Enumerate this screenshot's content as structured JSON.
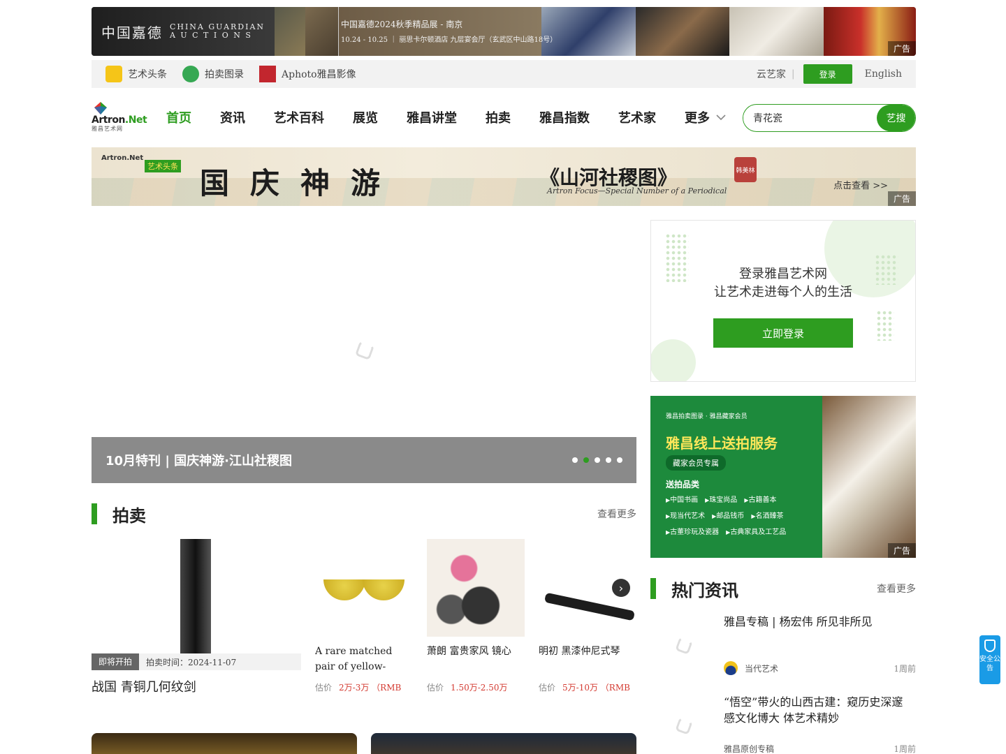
{
  "top_ad": {
    "brand_zh": "中国嘉德",
    "brand_en": "CHINA GUARDIAN",
    "brand_en2": "A U C T I O N S",
    "title": "中国嘉德2024秋季精品展 - 南京",
    "detail": "10.24 - 10.25 ｜ 丽思卡尔顿酒店 九层宴会厅（玄武区中山路18号）",
    "tag": "广告"
  },
  "subbar": {
    "links": [
      {
        "label": "艺术头条",
        "color": "#f5c518"
      },
      {
        "label": "拍卖图录",
        "color": "#36a853"
      },
      {
        "label": "Aphoto雅昌影像",
        "color": "#c2262e"
      }
    ],
    "cloud_artist": "云艺家",
    "login": "登录",
    "english": "English"
  },
  "nav": {
    "logo_name": "Artron",
    "logo_net": ".Net",
    "logo_sub": "雅昌艺术网",
    "items": [
      "首页",
      "资讯",
      "艺术百科",
      "展览",
      "雅昌讲堂",
      "拍卖",
      "雅昌指数",
      "艺术家",
      "更多"
    ],
    "search_value": "青花瓷",
    "search_button": "艺搜"
  },
  "banner": {
    "logo": "Artron.Net",
    "logo_tag": "艺术头条",
    "big_title": "国庆神游",
    "title": "《山河社稷图》",
    "subtitle": "Artron Focus—Special Number of a Periodical",
    "seal": "韩美林",
    "cta": "点击查看 >>",
    "tag": "广告"
  },
  "carousel": {
    "caption": "10月特刊 | 国庆神游·江山社稷图",
    "active_dot": 1,
    "dot_count": 5
  },
  "auction": {
    "heading": "拍卖",
    "more": "查看更多",
    "featured": {
      "badge": "即将开拍",
      "time": "拍卖时间：2024-11-07",
      "name": "战国 青铜几何纹剑"
    },
    "lots": [
      {
        "name": "A rare matched pair of yellow-ground green-…",
        "price_label": "估价",
        "price": "2万-3万 （RMB"
      },
      {
        "name": "萧朗 富贵家风 镜心",
        "price_label": "估价",
        "price": "1.50万-2.50万"
      },
      {
        "name": "明初 黑漆仲尼式琴",
        "price_label": "估价",
        "price": "5万-10万 （RMB"
      }
    ]
  },
  "login_card": {
    "line1": "登录雅昌艺术网",
    "line2": "让艺术走进每个人的生活",
    "button": "立即登录"
  },
  "green_ad": {
    "top": "雅昌拍卖图录 · 雅昌藏家会员",
    "heading": "雅昌线上送拍服务",
    "pill": "藏家会员专属",
    "send_title": "送拍品类",
    "items": [
      "中国书画",
      "珠宝尚品",
      "古籍善本",
      "现当代艺术",
      "邮品钱币",
      "名酒臻茶",
      "古董珍玩及瓷器",
      "古典家具及工艺品"
    ],
    "tag": "广告"
  },
  "hot_news": {
    "heading": "热门资讯",
    "more": "查看更多",
    "items": [
      {
        "title": "雅昌专稿 | 杨宏伟 所见非所见",
        "source": "当代艺术",
        "time": "1周前"
      },
      {
        "title": "“悟空”带火的山西古建：窥历史深邃 感文化博大 体艺术精妙",
        "source": "雅昌原创专稿",
        "time": "1周前"
      }
    ]
  },
  "notice": "安全公告"
}
